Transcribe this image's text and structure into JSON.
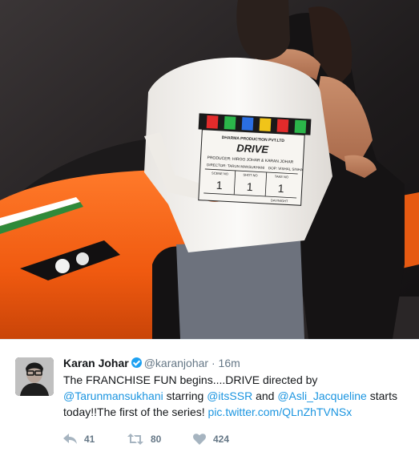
{
  "media": {
    "clapboard": {
      "company": "DHARMA PRODUCTION PVT.LTD",
      "title": "DRIVE",
      "producer": "PRODUCER: HIROO JOHAR & KARAN JOHAR",
      "director": "DIRECTOR: TARUN MANSUKHANI",
      "dop": "DOP: VISHAL SINHA",
      "scene_label": "SCENE NO",
      "shot_label": "SHOT NO",
      "take_label": "TAKE NO",
      "scene_value": "1",
      "shot_value": "1",
      "take_value": "1",
      "footer": "DAY/NIGHT"
    }
  },
  "tweet": {
    "author": {
      "name": "Karan Johar",
      "handle": "@karanjohar",
      "verified": true
    },
    "separator": "·",
    "time": "16m",
    "text": {
      "part1": "The FRANCHISE FUN begins....DRIVE directed by ",
      "mention1": "@Tarunmansukhani",
      "part2": " starring ",
      "mention2": "@itsSSR",
      "part3": " and ",
      "mention3": "@Asli_Jacqueline",
      "part4": " starts today!!The first of the series! ",
      "link": "pic.twitter.com/QLnZhTVNSx"
    },
    "actions": {
      "reply": {
        "icon": "reply-icon",
        "count": "41"
      },
      "retweet": {
        "icon": "retweet-icon",
        "count": "80"
      },
      "like": {
        "icon": "heart-icon",
        "count": "424"
      }
    }
  },
  "colors": {
    "link": "#1b95e0",
    "text": "#14171a",
    "muted": "#657786",
    "verified": "#1da1f2"
  }
}
